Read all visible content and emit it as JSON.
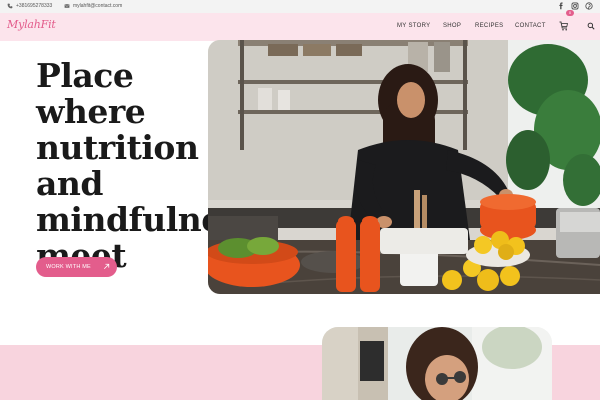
{
  "topbar": {
    "phone": "+381695278333",
    "email": "mylahfit@contact.com",
    "social_icons": [
      "facebook-icon",
      "instagram-icon",
      "pinterest-icon"
    ]
  },
  "header": {
    "logo": "MylahFit",
    "nav": [
      "MY STORY",
      "SHOP",
      "RECIPES",
      "CONTACT"
    ],
    "cart_count": "0",
    "icons": [
      "cart-icon",
      "search-icon"
    ]
  },
  "hero": {
    "title": "Place where nutrition and mindfulness meet",
    "cta_label": "WORK WITH ME",
    "cta_icon": "arrow-up-right-icon"
  },
  "colors": {
    "accent": "#e35d8c",
    "header_bg": "#fce4ec",
    "band_bg": "#f8d4de",
    "text": "#1a1a1a"
  }
}
